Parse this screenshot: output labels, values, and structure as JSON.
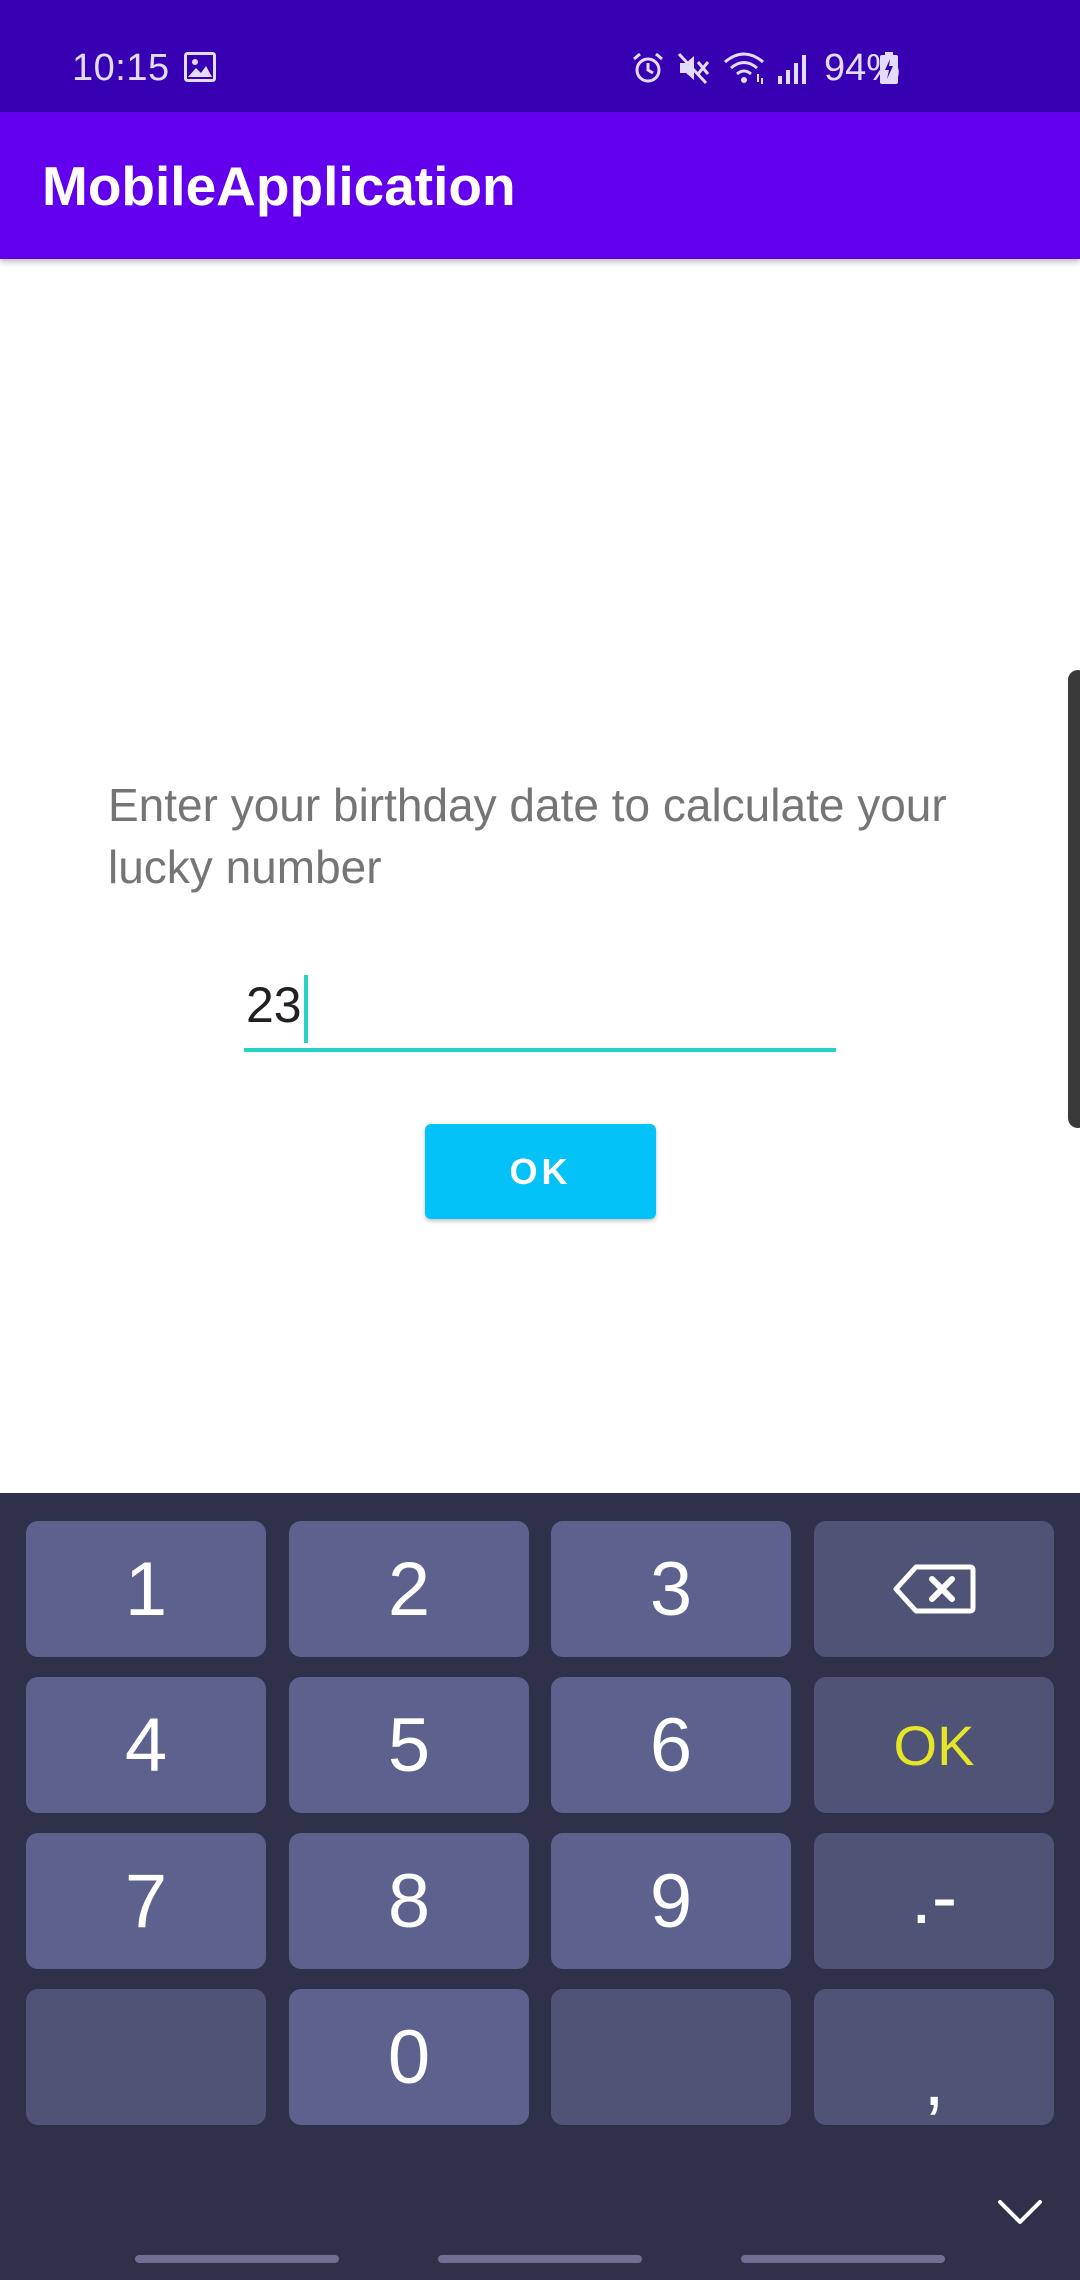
{
  "status_bar": {
    "time": "10:15",
    "battery_percent": "94%",
    "icons": [
      "gallery-icon",
      "alarm-icon",
      "mute-icon",
      "wifi-icon",
      "signal-icon",
      "battery-charging-icon"
    ]
  },
  "app_bar": {
    "title": "MobileApplication"
  },
  "main": {
    "prompt": "Enter your birthday date to calculate your lucky number",
    "input_value": "23",
    "ok_button_label": "OK"
  },
  "keyboard": {
    "keys": {
      "k1": "1",
      "k2": "2",
      "k3": "3",
      "backspace": "backspace-icon",
      "k4": "4",
      "k5": "5",
      "k6": "6",
      "ok": "OK",
      "k7": "7",
      "k8": "8",
      "k9": "9",
      "dot_dash": ".-",
      "blank_left": "",
      "k0": "0",
      "blank_right": "",
      "comma": ","
    },
    "collapse_icon": "chevron-down-icon"
  },
  "colors": {
    "status_bar": "#3700b3",
    "app_bar": "#6200ee",
    "accent": "#26d3c2",
    "button": "#03c2f8",
    "keyboard_bg": "#2e3149",
    "key": "#5c628d",
    "func_key": "#4f5376",
    "ok_key_text": "#e6e627"
  }
}
